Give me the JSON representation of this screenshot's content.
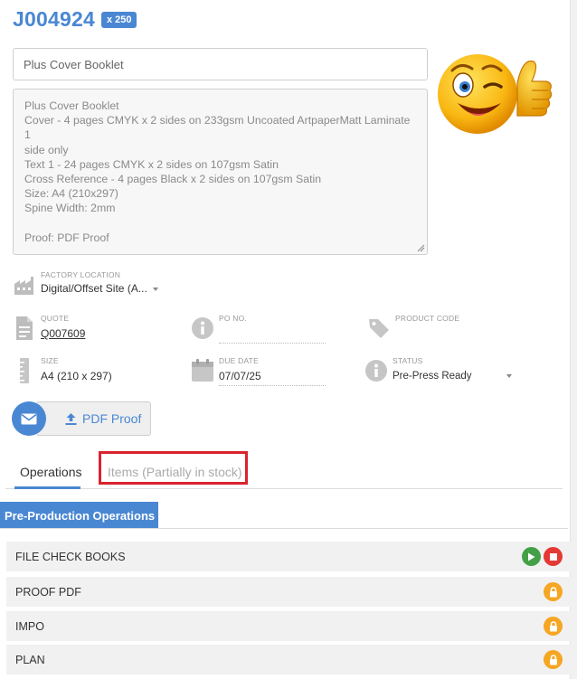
{
  "job": {
    "number": "J004924",
    "quantity_badge": "x 250"
  },
  "title_field": {
    "value": "Plus Cover Booklet"
  },
  "description": {
    "lines": [
      "Plus Cover Booklet",
      "Cover - 4 pages CMYK x 2 sides on 233gsm Uncoated ArtpaperMatt Laminate 1",
      "side only",
      "Text 1 - 24 pages CMYK x 2 sides on 107gsm Satin",
      "Cross Reference - 4 pages Black x 2 sides on 107gsm Satin",
      "Size: A4 (210x297)",
      "Spine Width: 2mm",
      "",
      "Proof: PDF Proof"
    ]
  },
  "factory_location": {
    "label": "FACTORY LOCATION",
    "value": "Digital/Offset Site (A..."
  },
  "quote": {
    "label": "QUOTE",
    "value": "Q007609"
  },
  "po_no": {
    "label": "PO NO.",
    "value": ""
  },
  "product_code": {
    "label": "PRODUCT CODE",
    "value": ""
  },
  "size": {
    "label": "SIZE",
    "value": "A4 (210 x 297)"
  },
  "due_date": {
    "label": "DUE DATE",
    "value": "07/07/25"
  },
  "status": {
    "label": "STATUS",
    "value": "Pre-Press Ready"
  },
  "actions": {
    "proof_label": "PDF Proof"
  },
  "tabs": [
    {
      "label": "Operations",
      "active": true
    },
    {
      "label": "Items (Partially in stock)",
      "active": false
    }
  ],
  "section": {
    "title": "Pre-Production Operations"
  },
  "operations": [
    {
      "name": "FILE CHECK BOOKS",
      "controls": [
        "play",
        "stop"
      ]
    },
    {
      "name": "PROOF PDF",
      "controls": [
        "lock"
      ]
    },
    {
      "name": "IMPO",
      "controls": [
        "lock"
      ]
    },
    {
      "name": "PLAN",
      "controls": [
        "lock"
      ]
    }
  ],
  "colors": {
    "accent": "#4a87d3",
    "highlight": "#d9232e",
    "play": "#43a047",
    "stop": "#e53935",
    "lock": "#f5a623"
  },
  "icons": {
    "factory": "factory-icon",
    "quote": "document-icon",
    "po": "info-icon",
    "product_code": "tag-icon",
    "size": "ruler-icon",
    "due_date": "calendar-icon",
    "status": "info-icon",
    "email": "envelope-icon",
    "upload": "upload-icon",
    "play": "play-icon",
    "stop": "stop-icon",
    "lock": "lock-icon",
    "emoji": "winking-thumbs-up-emoji"
  }
}
